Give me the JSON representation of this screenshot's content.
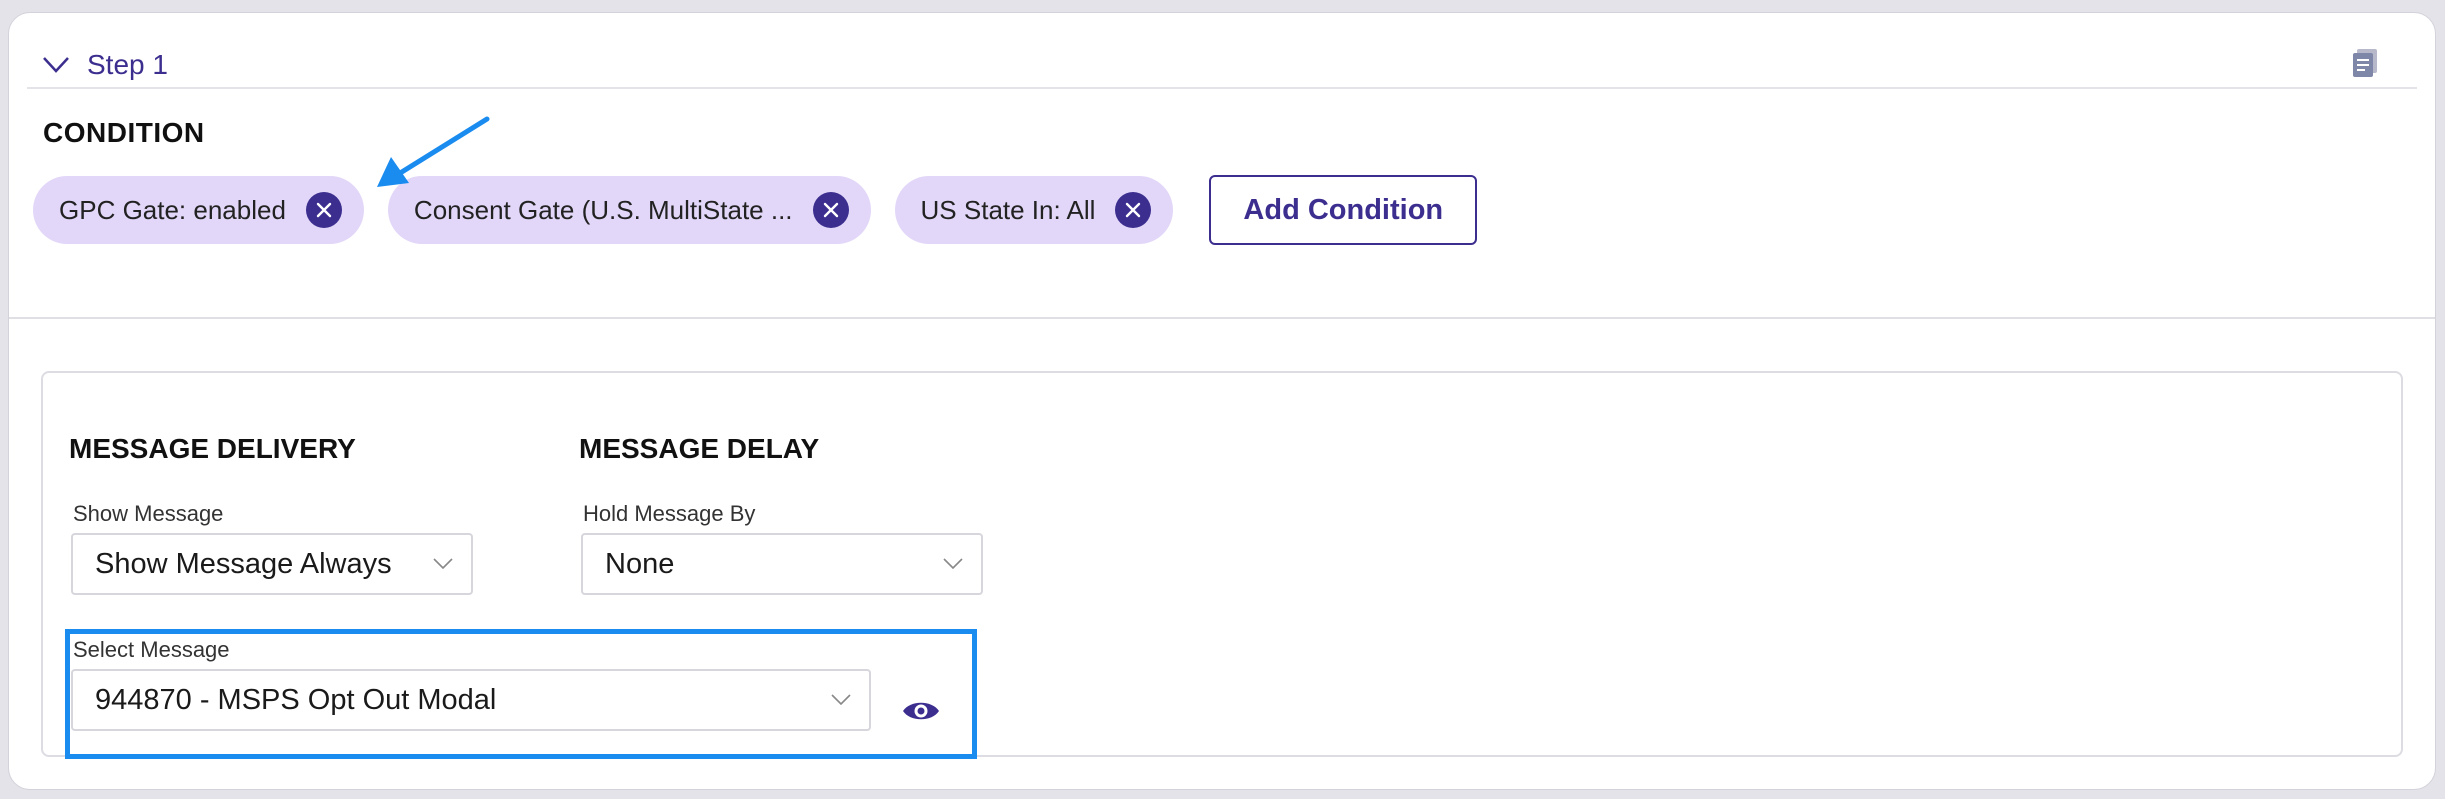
{
  "step": {
    "title": "Step 1"
  },
  "condition": {
    "heading": "CONDITION",
    "chips": [
      {
        "label": "GPC Gate: enabled"
      },
      {
        "label": "Consent Gate (U.S. MultiState ..."
      },
      {
        "label": "US State In: All"
      }
    ],
    "add_button_label": "Add Condition"
  },
  "delivery": {
    "heading": "MESSAGE DELIVERY",
    "show_message_label": "Show Message",
    "show_message_value": "Show Message Always"
  },
  "delay": {
    "heading": "MESSAGE DELAY",
    "hold_label": "Hold Message By",
    "hold_value": "None"
  },
  "select_message": {
    "label": "Select Message",
    "value": "944870 - MSPS Opt Out Modal"
  },
  "colors": {
    "brand_purple": "#3b2e8f",
    "chip_bg": "#e2d7f8",
    "annotation_blue": "#1a8cf0"
  },
  "icons": {
    "collapse": "chevron-down-icon",
    "notes": "notes-icon",
    "remove": "close-icon",
    "preview": "eye-icon",
    "annotation": "arrow-icon"
  }
}
